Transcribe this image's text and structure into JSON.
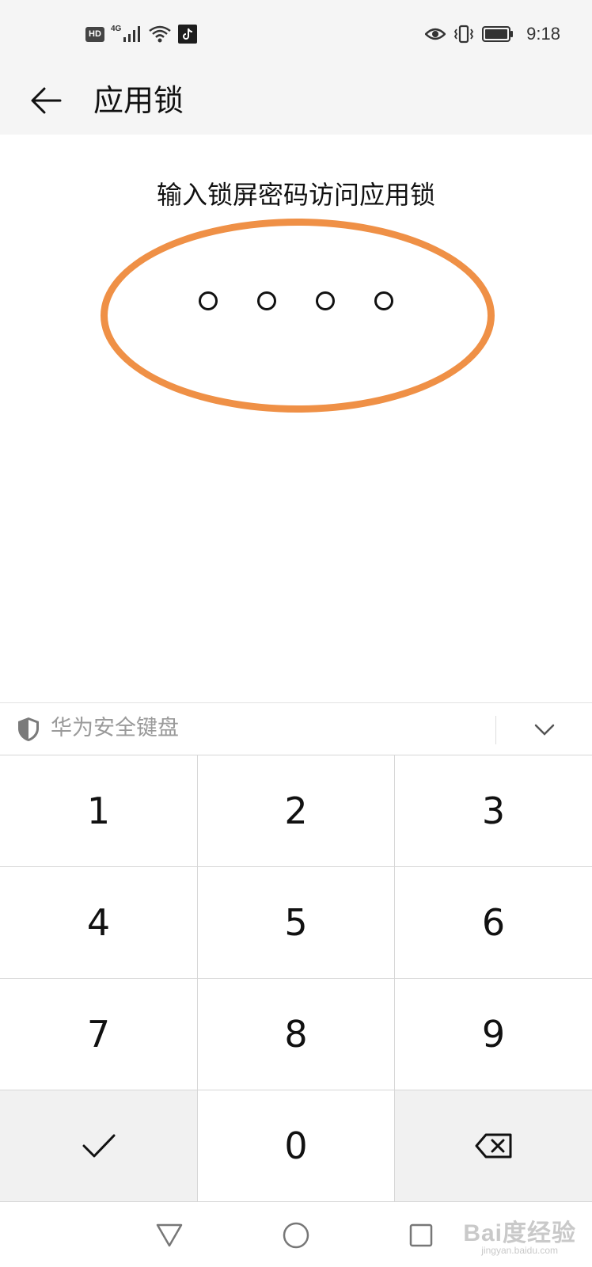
{
  "status_bar": {
    "hd_label": "HD",
    "network_label": "4G",
    "time": "9:18",
    "icons": [
      "hd-icon",
      "signal-icon",
      "wifi-icon",
      "tiktok-icon",
      "eye-icon",
      "vibrate-icon",
      "battery-icon"
    ]
  },
  "header": {
    "title": "应用锁"
  },
  "main": {
    "prompt": "输入锁屏密码访问应用锁",
    "pin_length": 4,
    "highlight_color": "#ef9046"
  },
  "keyboard": {
    "title": "华为安全键盘",
    "keys": [
      "1",
      "2",
      "3",
      "4",
      "5",
      "6",
      "7",
      "8",
      "9",
      "",
      "0",
      ""
    ]
  },
  "watermark": {
    "main": "Bai度经验",
    "sub": "jingyan.baidu.com"
  }
}
